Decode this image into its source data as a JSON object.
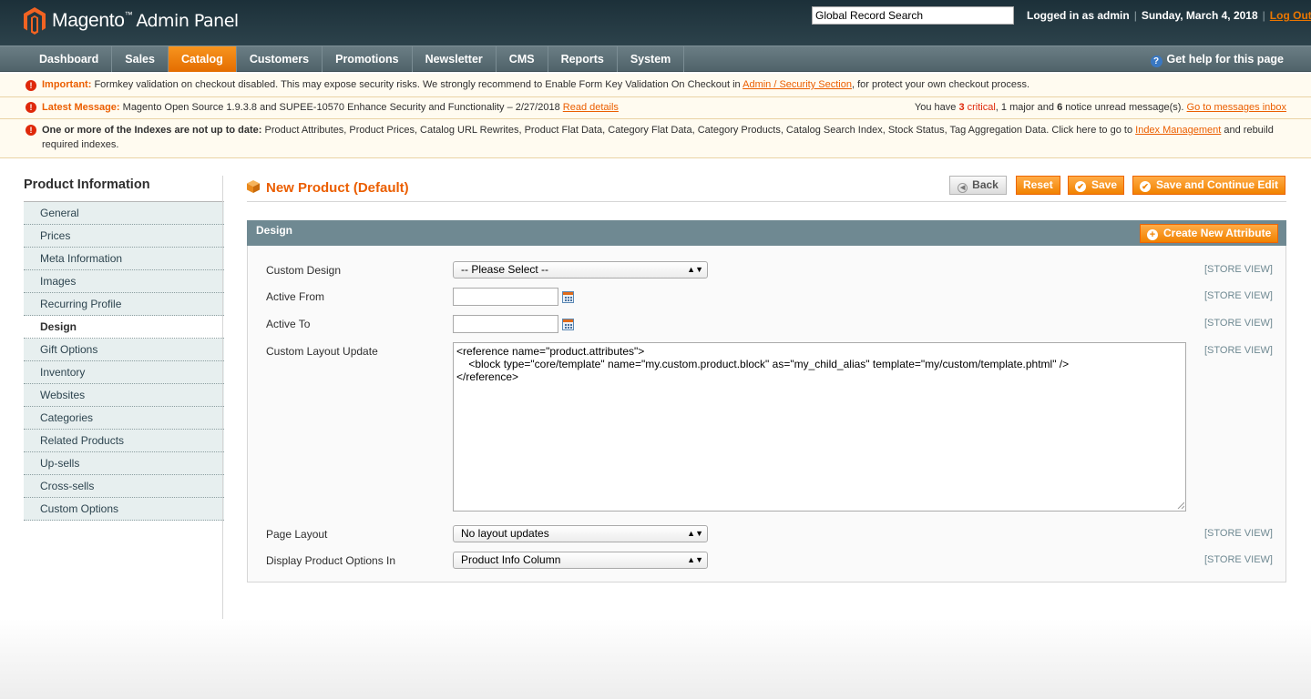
{
  "header": {
    "logo_brand": "Magento",
    "logo_tm": "™",
    "logo_suffix": "Admin Panel",
    "search_value": "Global Record Search",
    "logged_in": "Logged in as admin",
    "date": "Sunday, March 4, 2018",
    "logout": "Log Out"
  },
  "nav": {
    "items": [
      "Dashboard",
      "Sales",
      "Catalog",
      "Customers",
      "Promotions",
      "Newsletter",
      "CMS",
      "Reports",
      "System"
    ],
    "active": "Catalog",
    "help": "Get help for this page"
  },
  "notices": {
    "important_label": "Important:",
    "important_text": "Formkey validation on checkout disabled. This may expose security risks. We strongly recommend to Enable Form Key Validation On Checkout in",
    "important_link": "Admin / Security Section",
    "important_tail": ", for protect your own checkout process.",
    "latest_label": "Latest Message:",
    "latest_text": "Magento Open Source 1.9.3.8 and SUPEE-10570 Enhance Security and Functionality – 2/27/2018",
    "latest_link": "Read details",
    "msg_prefix": "You have",
    "msg_critical_count": "3",
    "msg_critical": "critical",
    "msg_major": ", 1 major and",
    "msg_notice_count": "6",
    "msg_notice": "notice unread message(s).",
    "msg_link": "Go to messages inbox",
    "index_label": "One or more of the Indexes are not up to date:",
    "index_text": "Product Attributes, Product Prices, Catalog URL Rewrites, Product Flat Data, Category Flat Data, Category Products, Catalog Search Index, Stock Status, Tag Aggregation Data. Click here to go to",
    "index_link": "Index Management",
    "index_tail": "and rebuild required indexes."
  },
  "sidebar": {
    "title": "Product Information",
    "tabs": [
      "General",
      "Prices",
      "Meta Information",
      "Images",
      "Recurring Profile",
      "Design",
      "Gift Options",
      "Inventory",
      "Websites",
      "Categories",
      "Related Products",
      "Up-sells",
      "Cross-sells",
      "Custom Options"
    ],
    "active": "Design"
  },
  "page": {
    "title": "New Product (Default)",
    "back": "Back",
    "reset": "Reset",
    "save": "Save",
    "save_continue": "Save and Continue Edit"
  },
  "fieldset": {
    "title": "Design",
    "create_attr": "Create New Attribute",
    "scope": "[STORE VIEW]",
    "custom_design_label": "Custom Design",
    "custom_design_value": "-- Please Select --",
    "active_from_label": "Active From",
    "active_to_label": "Active To",
    "layout_update_label": "Custom Layout Update",
    "layout_update_value": "<reference name=\"product.attributes\">\n    <block type=\"core/template\" name=\"my.custom.product.block\" as=\"my_child_alias\" template=\"my/custom/template.phtml\" />\n</reference>",
    "page_layout_label": "Page Layout",
    "page_layout_value": "No layout updates",
    "display_options_label": "Display Product Options In",
    "display_options_value": "Product Info Column"
  }
}
